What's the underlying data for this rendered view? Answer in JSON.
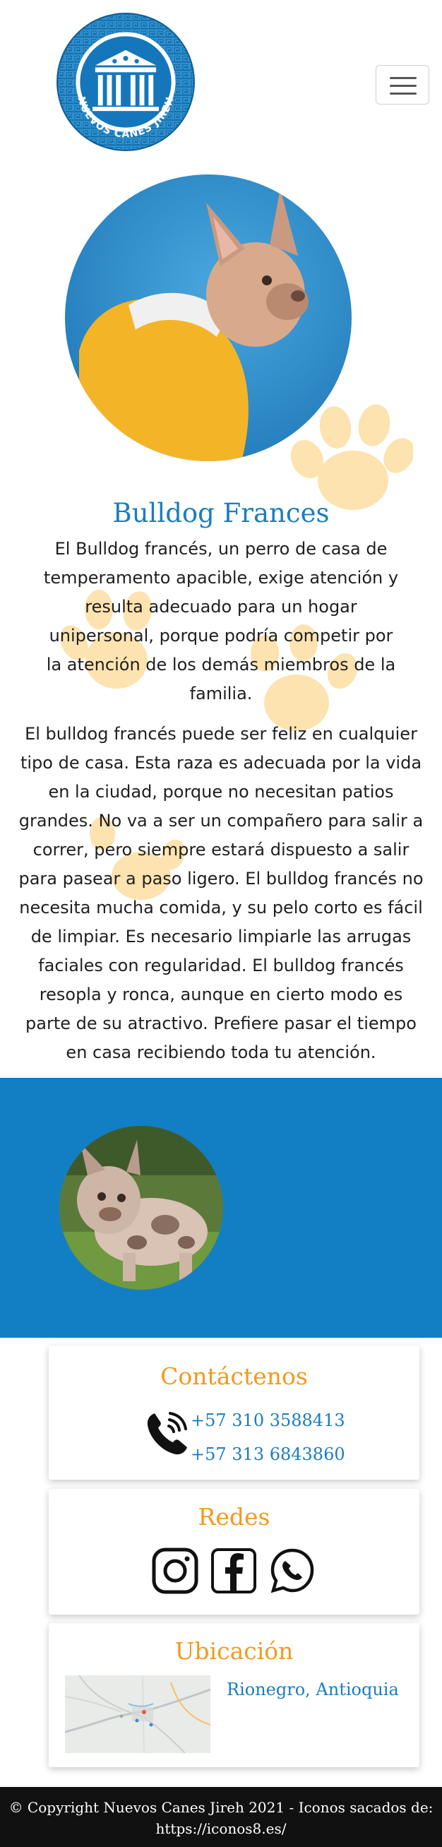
{
  "header": {
    "logo_text": "NUEVOS CANES JIREH",
    "menu_icon": "hamburger-icon"
  },
  "breed": {
    "title": "Bulldog Frances",
    "paragraph_1": "El Bulldog francés, un perro de casa de temperamento apacible, exige atención y resulta adecuado para un hogar unipersonal, porque podría competir por la atención de los demás miembros de la familia.",
    "paragraph_2": "El bulldog francés puede ser feliz en cualquier tipo de casa. Esta raza es adecuada por la vida en la ciudad, porque no necesitan patios grandes. No va a ser un compañero para salir a correr, pero siempre estará dispuesto a salir para pasear a paso ligero. El bulldog francés no necesita mucha comida, y su pelo corto es fácil de limpiar. Es necesario limpiarle las arrugas faciales con regularidad. El bulldog francés resopla y ronca, aunque en cierto modo es parte de su atractivo. Prefiere pasar el tiempo en casa recibiendo toda tu atención."
  },
  "contact": {
    "title": "Contáctenos",
    "phones": [
      "+57 310 3588413",
      "+57 313 6843860"
    ],
    "icon": "phone-icon"
  },
  "social": {
    "title": "Redes",
    "icons": [
      "instagram-icon",
      "facebook-icon",
      "whatsapp-icon"
    ]
  },
  "location": {
    "title": "Ubicación",
    "place": "Rionegro, Antioquia"
  },
  "footer": {
    "text_line_1": "© Copyright Nuevos Canes Jireh 2021 - Iconos sacados de:",
    "link": "https://iconos8.es/"
  },
  "colors": {
    "brand_blue": "#127fc4",
    "title_blue": "#1a7dc0",
    "accent_orange": "#f29a1e",
    "paw": "#fde3b0",
    "footer_bg": "#111111"
  }
}
